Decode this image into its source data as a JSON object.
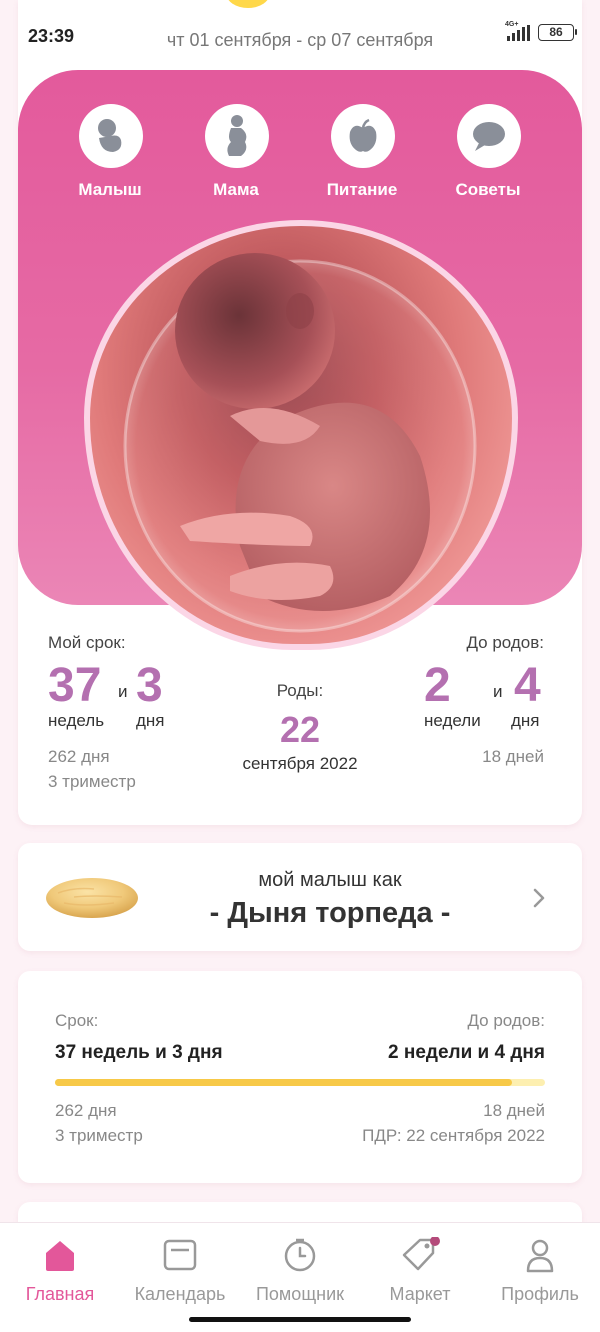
{
  "status_bar": {
    "time": "23:39",
    "network": "4G+",
    "battery": "86"
  },
  "header": {
    "week_range": "чт 01 сентября - ср 07 сентября"
  },
  "categories": [
    {
      "label": "Малыш",
      "icon": "baby-icon"
    },
    {
      "label": "Мама",
      "icon": "pregnant-woman-icon"
    },
    {
      "label": "Питание",
      "icon": "apple-icon"
    },
    {
      "label": "Советы",
      "icon": "chat-bubble-icon"
    }
  ],
  "term": {
    "my_term_label": "Мой срок:",
    "weeks": "37",
    "and": "и",
    "days": "3",
    "weeks_unit": "недель",
    "days_unit": "дня",
    "total_days": "262 дня",
    "trimester": "3 триместр",
    "birth_label": "Роды:",
    "birth_day": "22",
    "birth_month_year": "сентября 2022",
    "until_label": "До родов:",
    "until_weeks": "2",
    "until_and": "и",
    "until_days": "4",
    "until_weeks_unit": "недели",
    "until_days_unit": "дня",
    "until_total_days": "18 дней"
  },
  "size_card": {
    "caption": "мой малыш как",
    "fruit": "- Дыня торпеда -"
  },
  "progress_card": {
    "term_label": "Срок:",
    "term_value": "37 недель и 3 дня",
    "until_label": "До родов:",
    "until_value": "2 недели и 4 дня",
    "progress": 0.933,
    "total_days": "262 дня",
    "trimester": "3 триместр",
    "until_days": "18 дней",
    "due_date": "ПДР: 22 сентября 2022"
  },
  "bottom_nav": [
    {
      "label": "Главная",
      "icon": "home-icon",
      "active": true
    },
    {
      "label": "Календарь",
      "icon": "calendar-icon",
      "active": false
    },
    {
      "label": "Помощник",
      "icon": "clock-icon",
      "active": false
    },
    {
      "label": "Маркет",
      "icon": "tag-icon",
      "active": false
    },
    {
      "label": "Профиль",
      "icon": "profile-icon",
      "active": false
    }
  ],
  "colors": {
    "accent": "#e3579a",
    "number": "#b470b0",
    "progress": "#f7c948"
  }
}
